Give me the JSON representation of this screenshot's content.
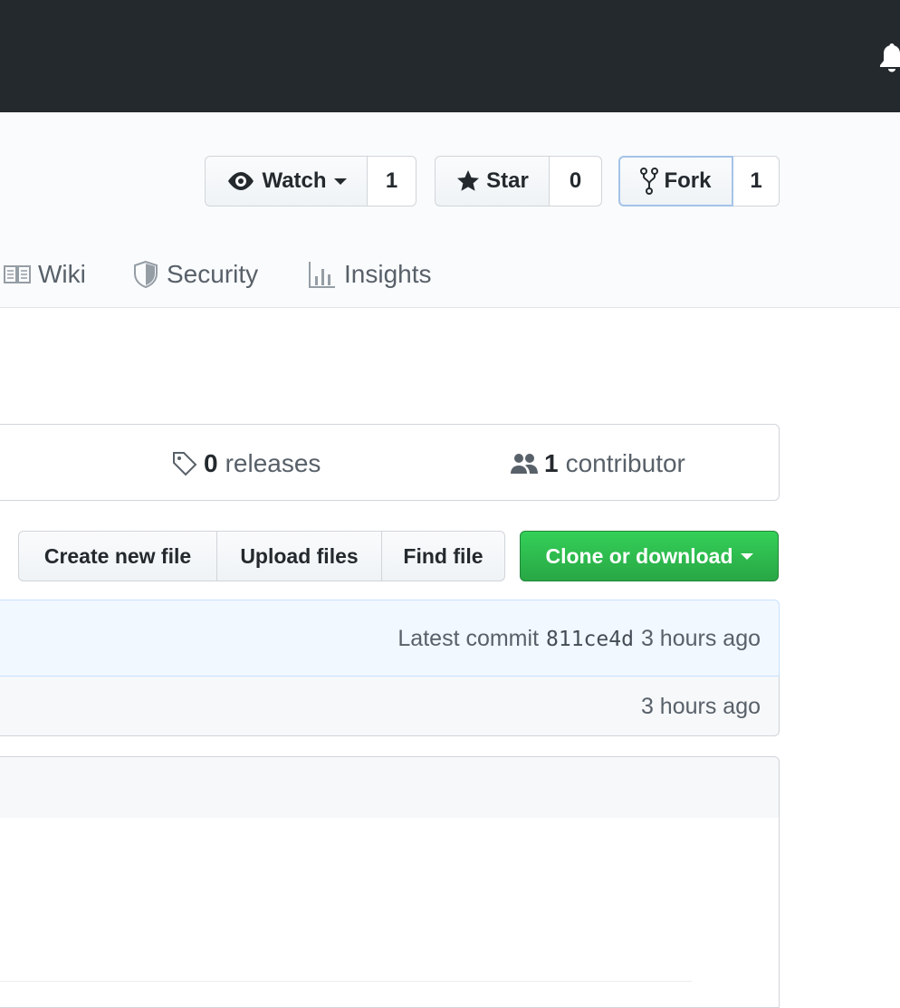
{
  "header": {
    "bell_icon": "bell-icon"
  },
  "actions": {
    "watch": {
      "label": "Watch",
      "count": "1",
      "icon": "eye-icon"
    },
    "star": {
      "label": "Star",
      "count": "0",
      "icon": "star-icon"
    },
    "fork": {
      "label": "Fork",
      "count": "1",
      "icon": "repo-forked-icon"
    }
  },
  "tabs": [
    {
      "label": "Wiki",
      "icon": "book-icon"
    },
    {
      "label": "Security",
      "icon": "shield-icon"
    },
    {
      "label": "Insights",
      "icon": "graph-icon"
    }
  ],
  "summary": {
    "releases": {
      "count": "0",
      "label": "releases",
      "icon": "tag-icon"
    },
    "contributors": {
      "count": "1",
      "label": "contributor",
      "icon": "people-icon"
    }
  },
  "file_actions": {
    "create": "Create new file",
    "upload": "Upload files",
    "find": "Find file",
    "clone": "Clone or download"
  },
  "commit": {
    "prefix": "Latest commit",
    "sha": "811ce4d",
    "time": "3 hours ago"
  },
  "files": [
    {
      "time": "3 hours ago"
    }
  ],
  "colors": {
    "header_bg": "#24292e",
    "clone_green": "#28a745",
    "commit_bg": "#f1f8ff"
  }
}
